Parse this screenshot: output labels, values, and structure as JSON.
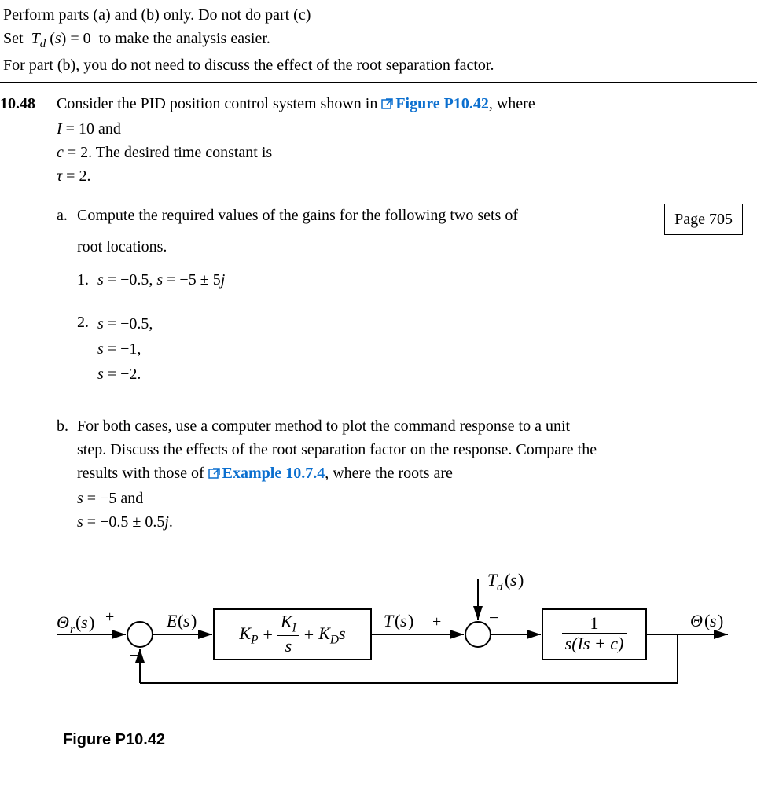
{
  "intro": {
    "line1_pre": "Perform parts (a) and (b) only.  Do not do part (c)",
    "line2": "Set  Td (s) = 0  to make the analysis easier.",
    "line3": "For part (b), you do not need to discuss the effect of the root separation factor."
  },
  "problem": {
    "number": "10.48",
    "lead_pre": "Consider the PID position control system shown in ",
    "lead_link": "Figure P10.42",
    "lead_post": ", where",
    "given1": "I = 10 and",
    "given2": "c = 2. The desired time constant is",
    "given3": "τ = 2.",
    "page_badge": "Page 705",
    "part_a": {
      "label": "a.",
      "text1": "Compute the required values of the gains for the following two sets of",
      "text2": "root locations.",
      "item1": {
        "label": "1.",
        "text": "s = −0.5, s = −5 ± 5j"
      },
      "item2": {
        "label": "2.",
        "l1": "s = −0.5,",
        "l2": "s = −1,",
        "l3": "s = −2."
      }
    },
    "part_b": {
      "label": "b.",
      "text1": "For both cases, use a computer method to plot the command response to a unit",
      "text2": "step. Discuss the effects of the root separation factor on the response. Compare the",
      "text3_pre": "results with those of ",
      "text3_link": "Example 10.7.4",
      "text3_post": ", where the roots are",
      "l1": "s = −5 and",
      "l2": "s = −0.5 ± 0.5j."
    }
  },
  "figure": {
    "caption": "Figure P10.42",
    "in_label": "Θr(s)",
    "e_label": "E(s)",
    "t_label": "T(s)",
    "td_label": "Td(s)",
    "out_label": "Θ(s)",
    "plus1": "+",
    "minus1": "−",
    "plus2": "+",
    "minus2": "−",
    "controller": {
      "kp": "KP",
      "plus": " + ",
      "ki": "KI",
      "over": "s",
      "plus2": " + ",
      "kd": "KDs"
    },
    "plant": {
      "num": "1",
      "den": "s(Is + c)"
    }
  }
}
